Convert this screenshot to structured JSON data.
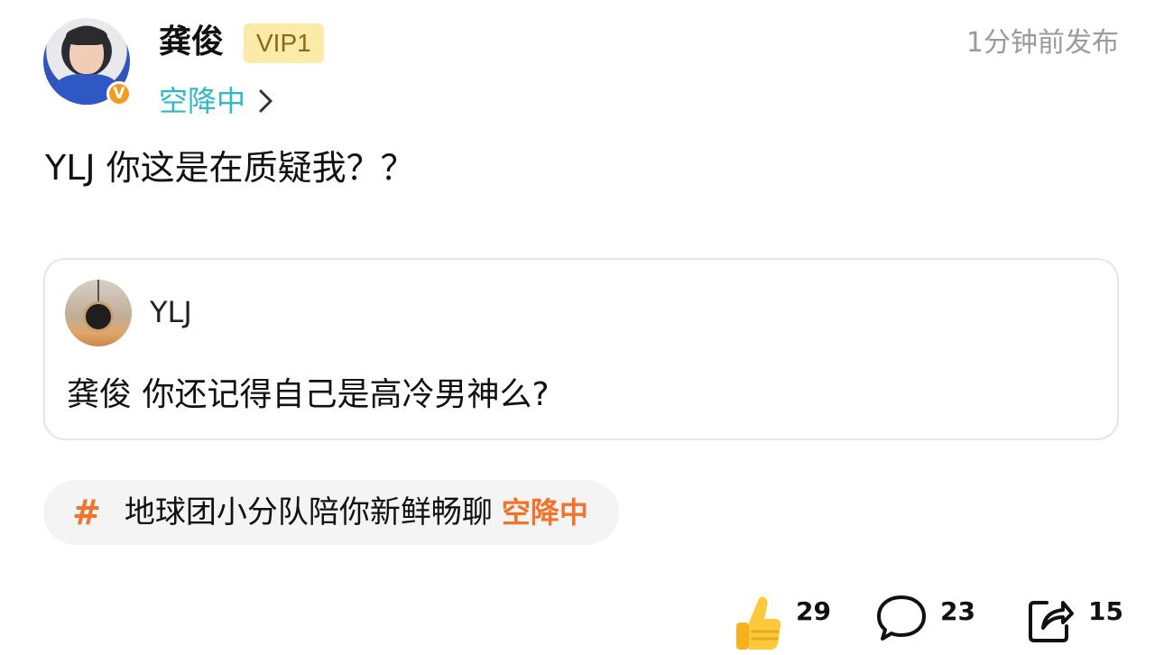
{
  "post": {
    "author": {
      "name": "龚俊",
      "vip_label": "VIP1",
      "verified_badge": "V"
    },
    "timestamp": "1分钟前发布",
    "source": "空降中",
    "text": "YLJ 你这是在质疑我？？"
  },
  "quoted": {
    "author_name": "YLJ",
    "text": "龚俊 你还记得自己是高冷男神么?"
  },
  "topic": {
    "icon": "hash-icon",
    "text": "地球团小分队陪你新鲜畅聊",
    "tag": "空降中"
  },
  "actions": {
    "like_count": "29",
    "comment_count": "23",
    "share_count": "15"
  },
  "colors": {
    "accent_cyan": "#2fb8c8",
    "accent_orange": "#f2742c",
    "vip_bg": "#fbeaa8",
    "badge_orange": "#f59a23"
  }
}
